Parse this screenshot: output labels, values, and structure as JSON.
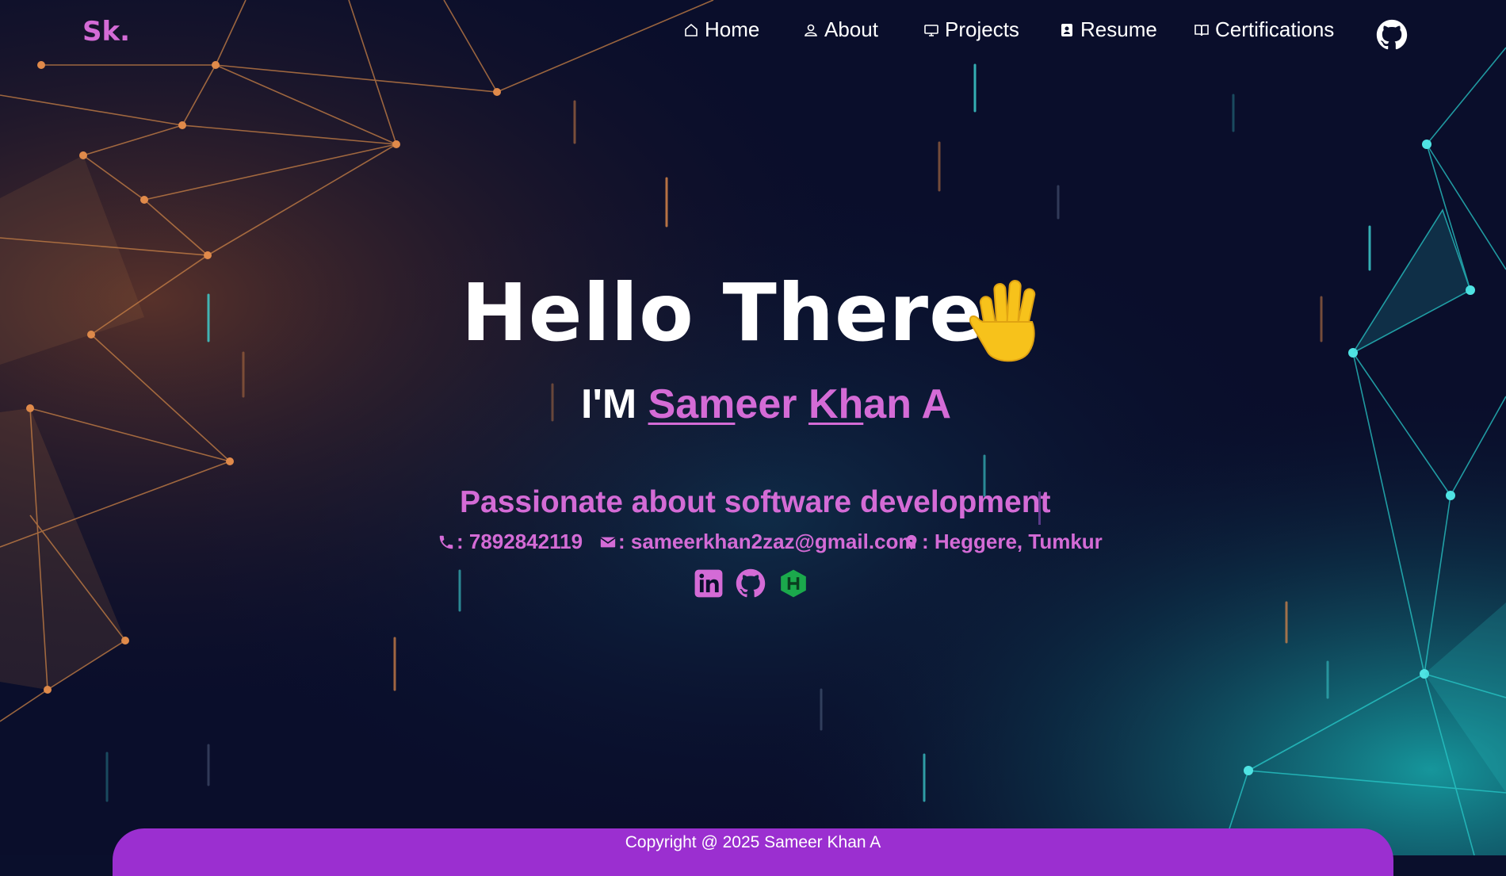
{
  "brand": {
    "logo": "Sk."
  },
  "nav": {
    "items": [
      {
        "label": "Home",
        "icon": "home-icon"
      },
      {
        "label": "About",
        "icon": "user-icon"
      },
      {
        "label": "Projects",
        "icon": "monitor-icon"
      },
      {
        "label": "Resume",
        "icon": "document-icon"
      },
      {
        "label": "Certifications",
        "icon": "book-icon"
      }
    ],
    "github_icon": "github-icon"
  },
  "hero": {
    "greeting": "Hello There,",
    "greeting_icon": "waving-hand-icon",
    "intro_prefix": "I'M ",
    "name_part1": "Sam",
    "name_part2": "eer ",
    "name_part3": "Kh",
    "name_part4": "an A",
    "tagline": "Passionate about software development"
  },
  "contact": {
    "phone": ": 7892842119",
    "email": ": sameerkhan2zaz@gmail.com",
    "location": ": Heggere, Tumkur"
  },
  "social": [
    {
      "icon": "linkedin-icon"
    },
    {
      "icon": "github-icon"
    },
    {
      "icon": "hackerrank-icon"
    }
  ],
  "footer": {
    "copyright": "Copyright @ 2025 Sameer Khan A"
  },
  "colors": {
    "accent": "#d46bd6",
    "footer": "#9b2fd0",
    "background": "#0a0f2c",
    "hackerrank": "#1ba94c"
  }
}
